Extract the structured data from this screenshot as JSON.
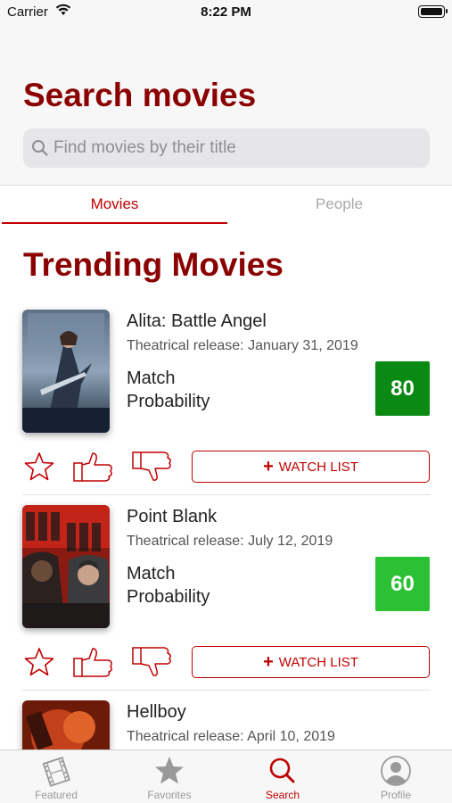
{
  "status_bar": {
    "carrier": "Carrier",
    "time": "8:22 PM"
  },
  "header": {
    "title": "Search movies",
    "search_placeholder": "Find movies by their title",
    "search_value": ""
  },
  "tabs": [
    {
      "label": "Movies",
      "active": true
    },
    {
      "label": "People",
      "active": false
    }
  ],
  "section_title": "Trending Movies",
  "movies": [
    {
      "title": "Alita: Battle Angel",
      "release": "Theatrical release: January 31, 2019",
      "match_label": "Match Probability",
      "score": "80",
      "score_color": "#0a8a12",
      "watch_label": "WATCH LIST"
    },
    {
      "title": "Point Blank",
      "release": "Theatrical release: July 12, 2019",
      "match_label": "Match Probability",
      "score": "60",
      "score_color": "#2cc135",
      "watch_label": "WATCH LIST"
    },
    {
      "title": "Hellboy",
      "release": "Theatrical release: April 10, 2019"
    }
  ],
  "tab_bar": [
    {
      "label": "Featured",
      "icon": "film-icon",
      "active": false
    },
    {
      "label": "Favorites",
      "icon": "star-icon",
      "active": false
    },
    {
      "label": "Search",
      "icon": "search-icon",
      "active": true
    },
    {
      "label": "Profile",
      "icon": "profile-icon",
      "active": false
    }
  ],
  "colors": {
    "accent": "#c00000",
    "title": "#8b0000",
    "score_high": "#0a8a12",
    "score_mid": "#2cc135"
  }
}
